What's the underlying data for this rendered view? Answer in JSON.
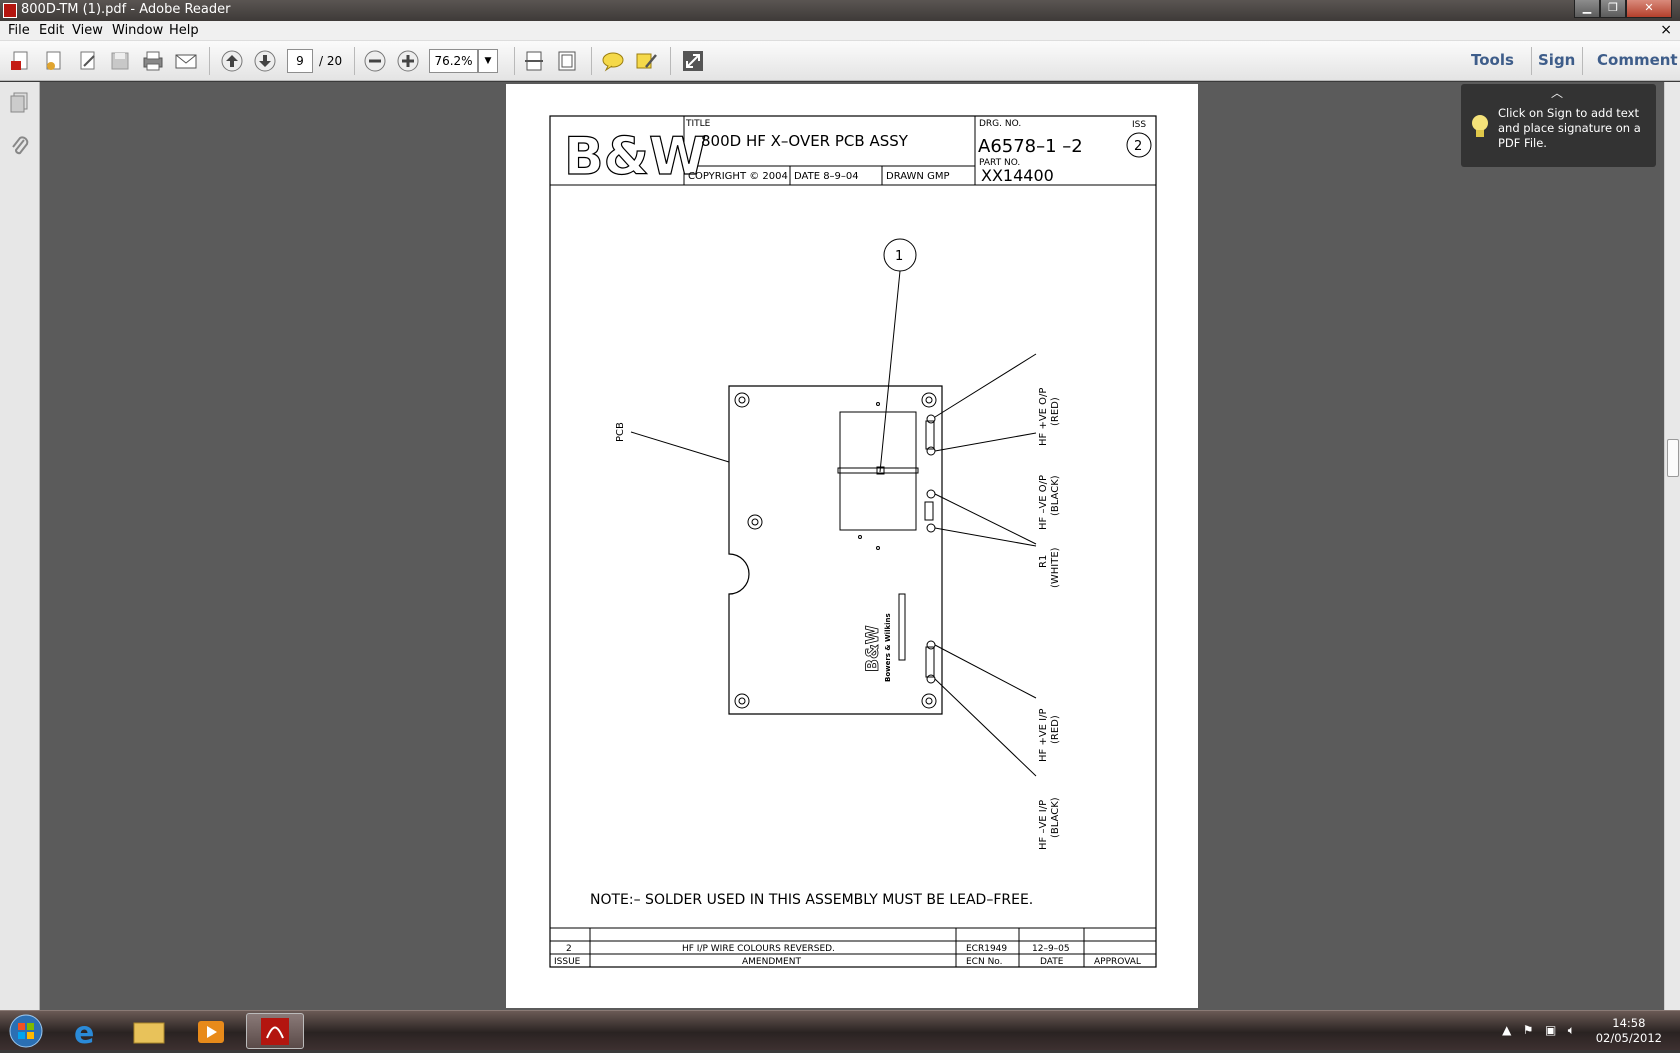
{
  "window": {
    "title": "800D-TM (1).pdf - Adobe Reader",
    "minimize_icon": "minimize-icon",
    "restore_icon": "restore-icon",
    "close_icon": "close-icon"
  },
  "menu": {
    "items": [
      "File",
      "Edit",
      "View",
      "Window",
      "Help"
    ],
    "doc_close": "×"
  },
  "toolbar": {
    "page_current": "9",
    "page_total": "/ 20",
    "zoom": "76.2%",
    "right_links": {
      "tools": "Tools",
      "sign": "Sign",
      "comment": "Comment"
    }
  },
  "tooltip": {
    "text": "Click on Sign to add text and place signature on a PDF File."
  },
  "drawing": {
    "logo": "B&W",
    "title_label": "TITLE",
    "title": "800D  HF  X–OVER  PCB  ASSY",
    "drg_label": "DRG. NO.",
    "drg_no": "A6578–1  –2",
    "iss_label": "ISS",
    "iss": "2",
    "part_label": "PART NO.",
    "part_no": "XX14400",
    "copyright": "COPYRIGHT © 2004",
    "date": "DATE  8–9–04",
    "drawn": "DRAWN  GMP",
    "balloon": "1",
    "pcb_label": "PCB",
    "pcb_brand": "B&W",
    "pcb_brand_sub": "Bowers & Wilkins",
    "callouts": [
      {
        "line1": "HF  +VE  O/P",
        "line2": "(RED)"
      },
      {
        "line1": "HF  –VE  O/P",
        "line2": "(BLACK)"
      },
      {
        "line1": "R1",
        "line2": "(WHITE)"
      },
      {
        "line1": "HF  +VE  I/P",
        "line2": "(RED)"
      },
      {
        "line1": "HF  –VE  I/P",
        "line2": "(BLACK)"
      }
    ],
    "note": "NOTE:–  SOLDER  USED  IN  THIS  ASSEMBLY  MUST  BE  LEAD–FREE.",
    "revision": {
      "issue": "2",
      "amendment": "HF  I/P  WIRE  COLOURS  REVERSED.",
      "ecn": "ECR1949",
      "date": "12–9–05",
      "approval": ""
    },
    "rev_headers": {
      "issue": "ISSUE",
      "amendment": "AMENDMENT",
      "ecn": "ECN  No.",
      "date": "DATE",
      "approval": "APPROVAL"
    }
  },
  "taskbar": {
    "time": "14:58",
    "date": "02/05/2012"
  }
}
